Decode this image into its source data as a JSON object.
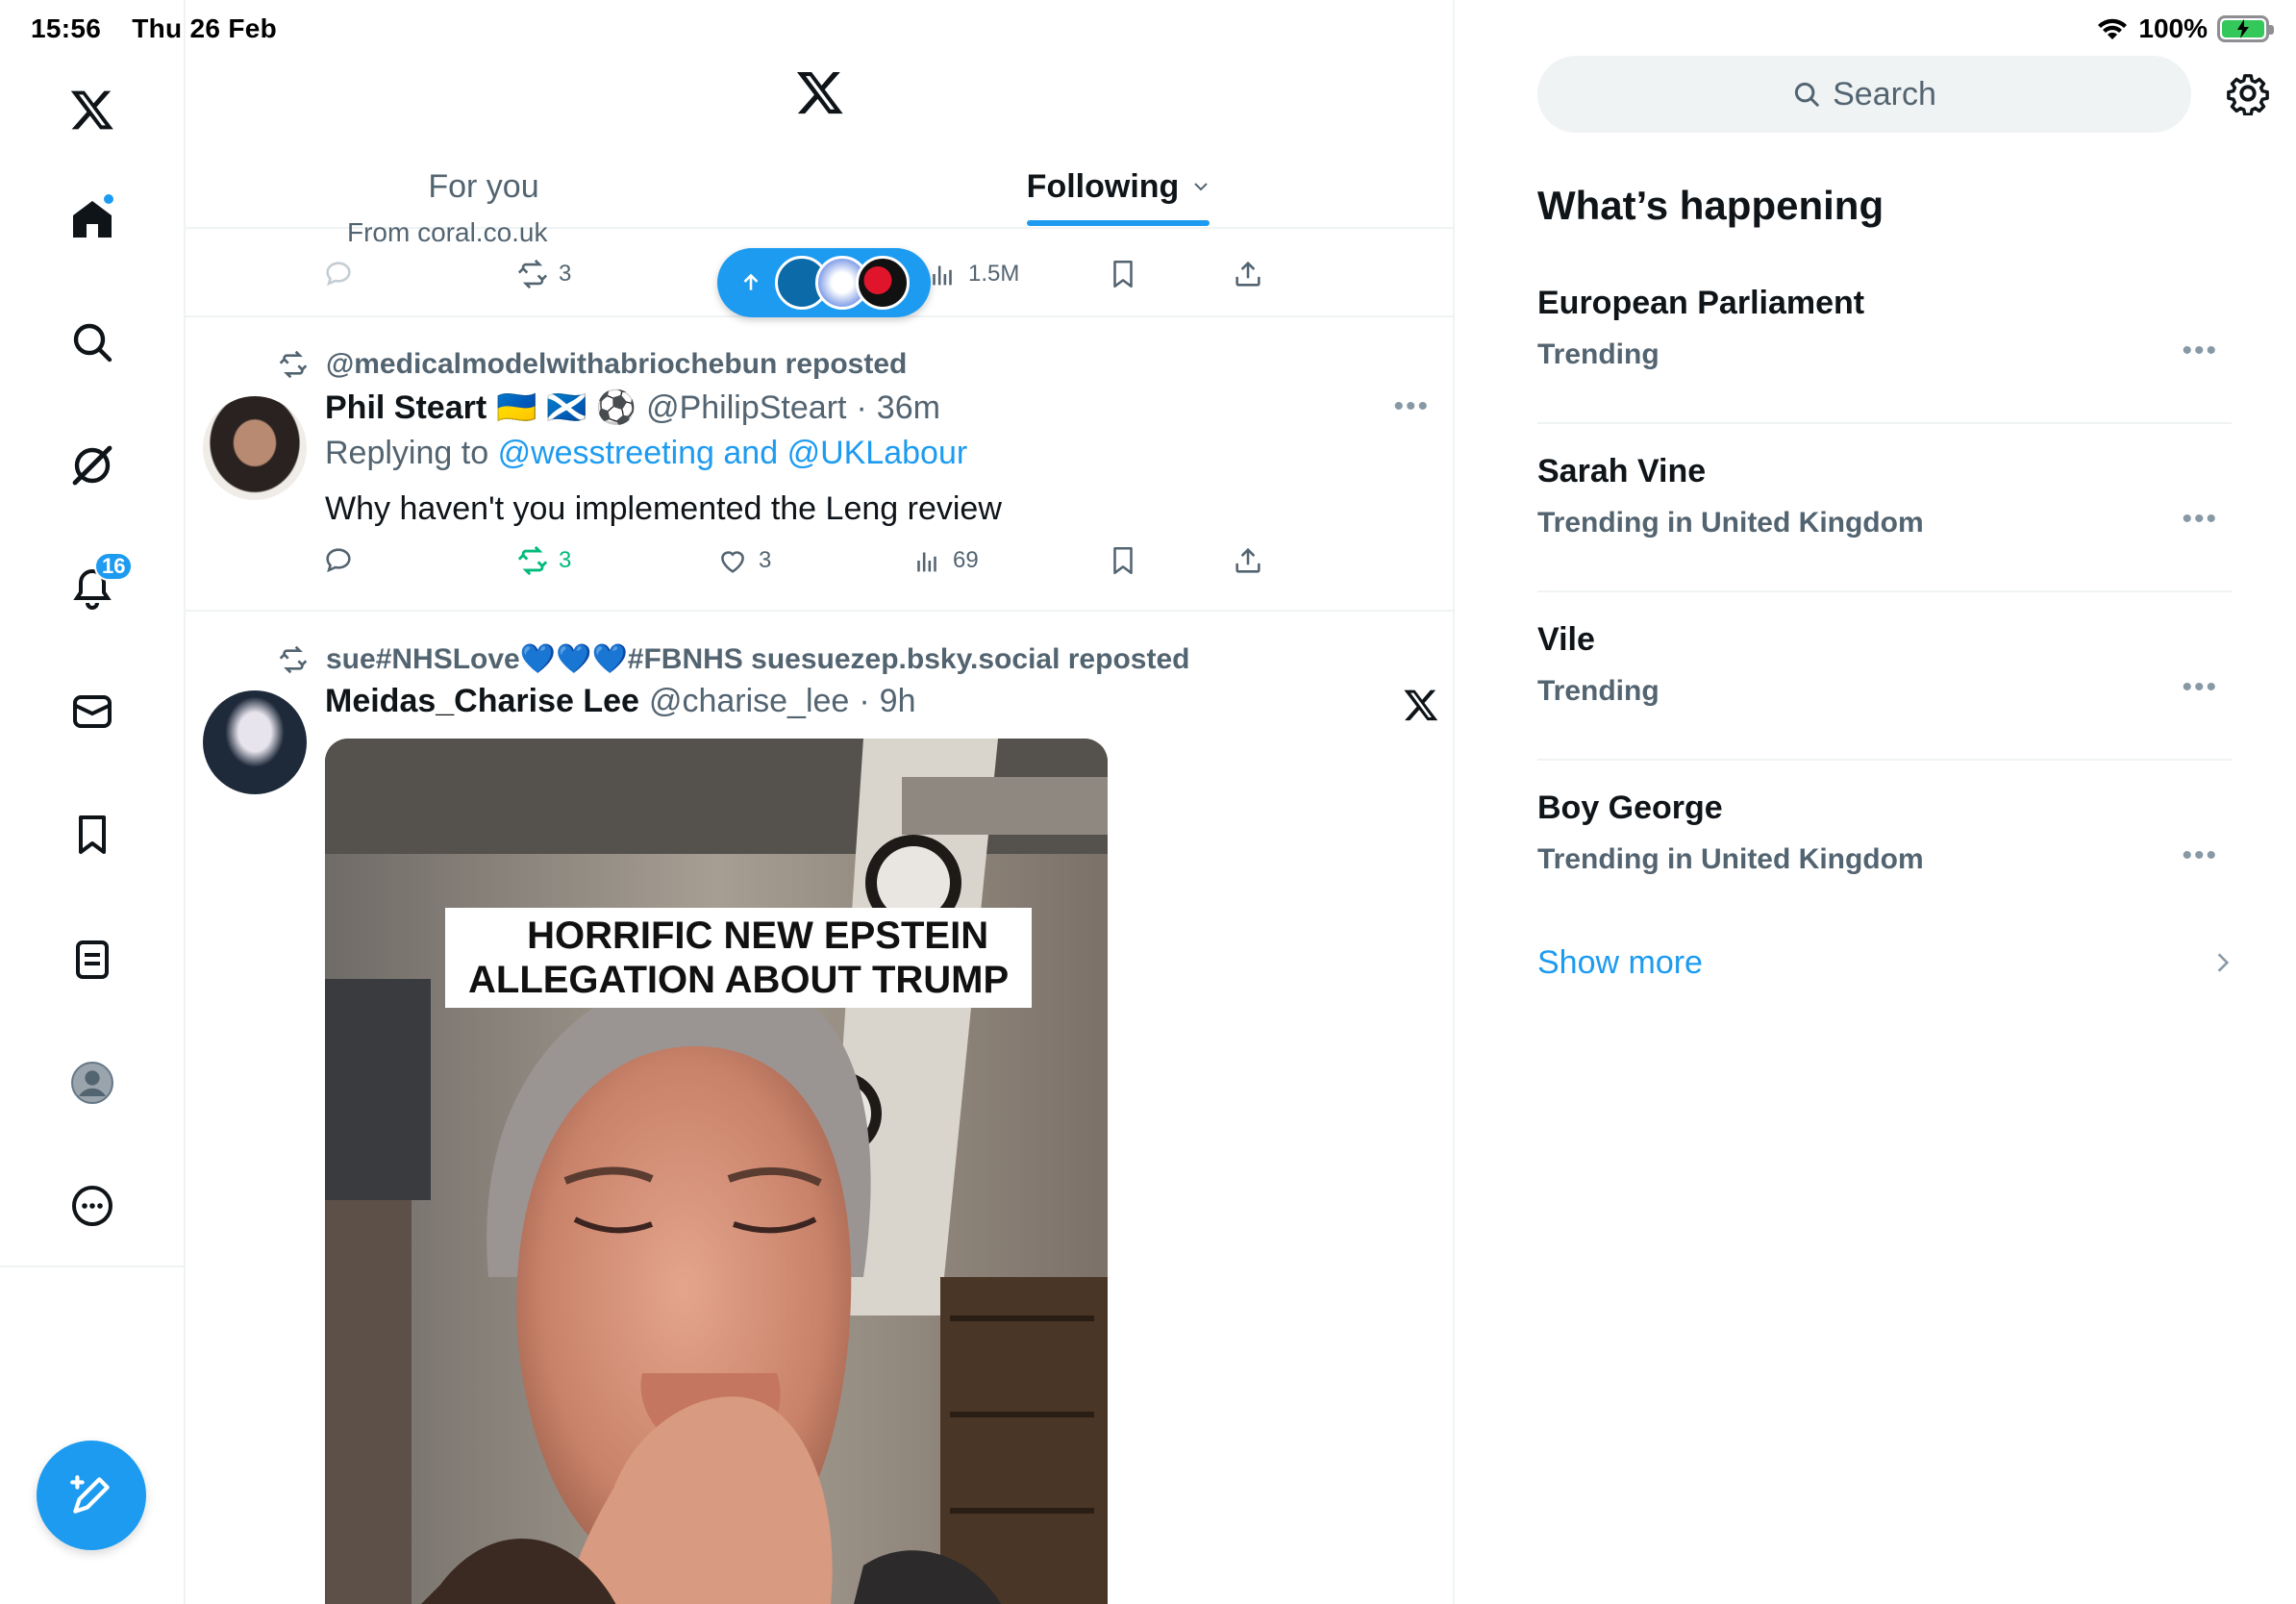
{
  "status_bar": {
    "time": "15:56",
    "date": "Thu 26 Feb",
    "battery": "100%"
  },
  "nav": {
    "notifications_badge": "16"
  },
  "tabs": [
    {
      "label": "For you"
    },
    {
      "label": "Following"
    }
  ],
  "previous_tweet": {
    "source_partial": "From coral.co.uk",
    "retweets": "3",
    "views": "1.5M"
  },
  "tweet1": {
    "reposted_by": "@medicalmodelwithabriochebun reposted",
    "name": "Phil Steart",
    "name_emoji": "🇺🇦 🏴󠁧󠁢󠁳󠁣󠁴󠁿 ⚽",
    "handle": "@PhilipSteart",
    "separator": "·",
    "time": "36m",
    "replying_label": "Replying to",
    "replying_to": "@wesstreeting and @UKLabour",
    "text": "Why haven't you implemented the Leng review",
    "retweets": "3",
    "likes": "3",
    "views": "69"
  },
  "tweet2": {
    "reposted_by": "sue#NHSLove💙💙💙#FBNHS suesuezep.bsky.social reposted",
    "name": "Meidas_Charise Lee",
    "handle": "@charise_lee",
    "separator": "·",
    "time": "9h",
    "caption_line1": "HORRIFIC NEW EPSTEIN",
    "caption_line2": "ALLEGATION ABOUT TRUMP"
  },
  "sidebar": {
    "search_label": "Search",
    "section_title": "What’s happening",
    "trends": [
      {
        "name": "European Parliament",
        "context": "Trending"
      },
      {
        "name": "Sarah Vine",
        "context": "Trending in United Kingdom"
      },
      {
        "name": "Vile",
        "context": "Trending"
      },
      {
        "name": "Boy George",
        "context": "Trending in United Kingdom"
      }
    ],
    "show_more": "Show more"
  },
  "colors": {
    "accent": "#1d9bf0",
    "retweet_green": "#00ba7c",
    "muted": "#536471"
  }
}
